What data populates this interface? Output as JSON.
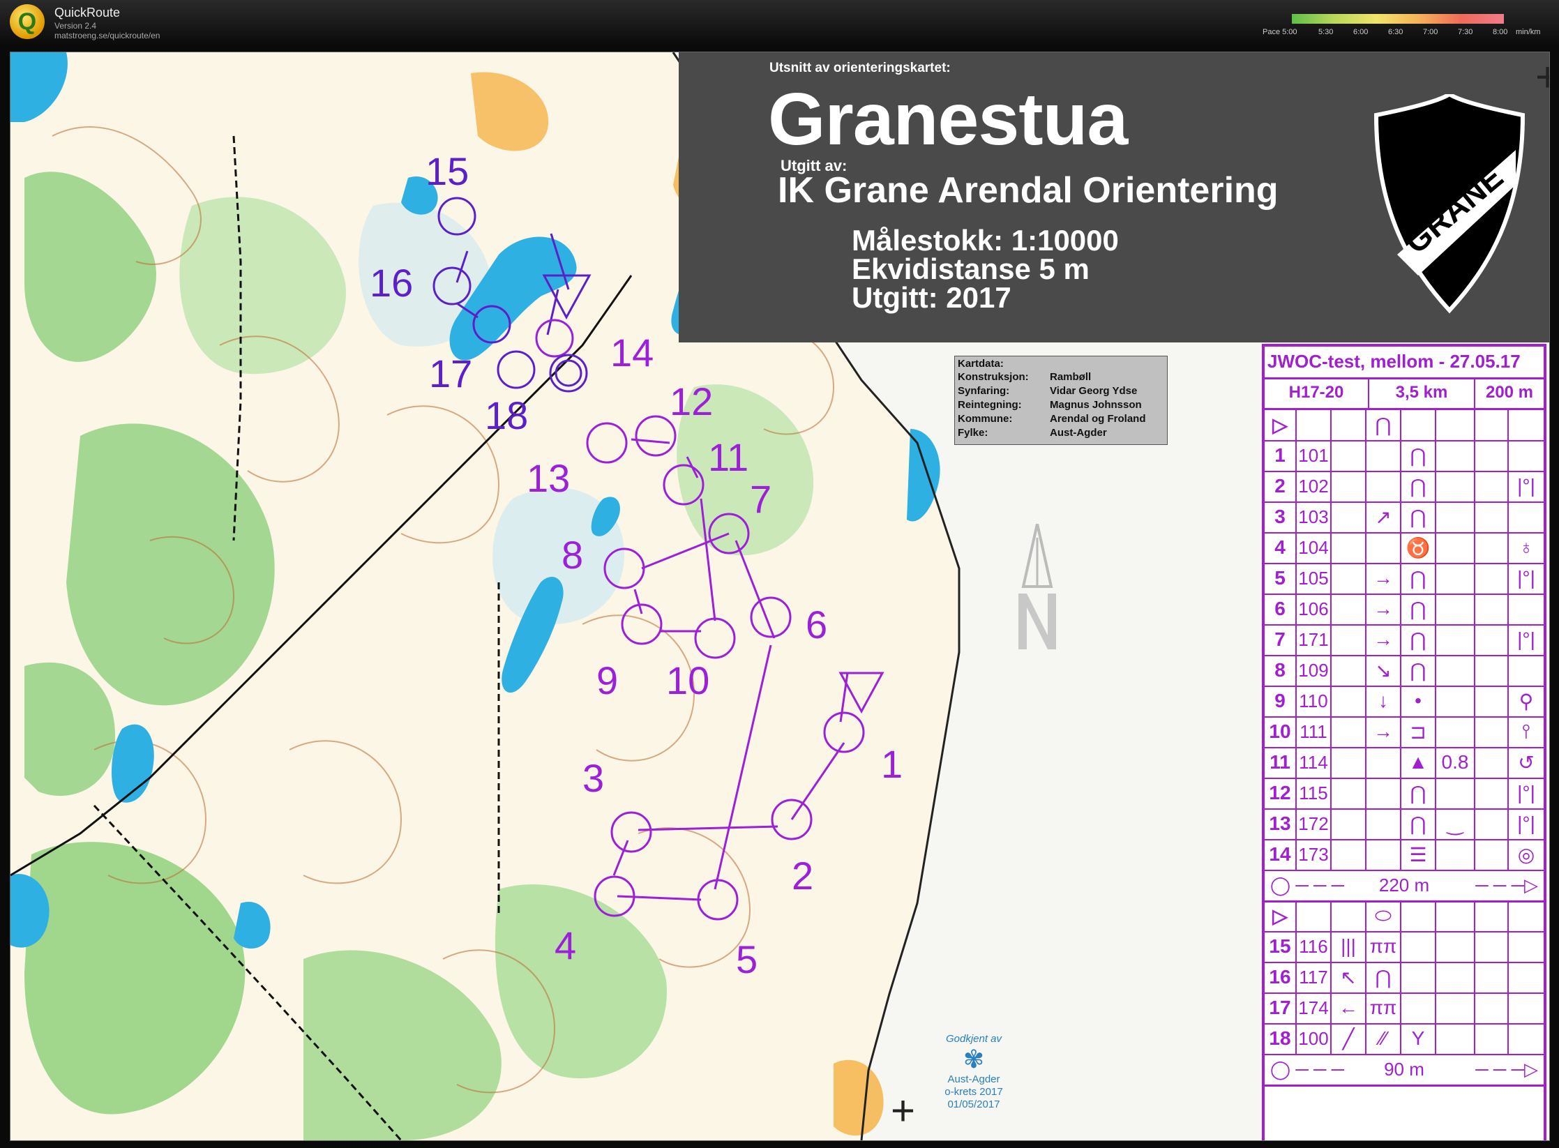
{
  "app": {
    "name": "QuickRoute",
    "version": "Version 2.4",
    "url": "matstroeng.se/quickroute/en",
    "logo_letter": "Q"
  },
  "pace_legend": {
    "labels": [
      "Pace 5:00",
      "5:30",
      "6:00",
      "6:30",
      "7:00",
      "7:30",
      "8:00",
      "min/km"
    ]
  },
  "map": {
    "header_small": "Utsnitt av orienteringskartet:",
    "title": "Granestua",
    "publisher_label": "Utgitt av:",
    "club": "IK Grane Arendal Orientering",
    "scale": "Målestokk: 1:10000",
    "contour": "Ekvidistanse 5 m",
    "published": "Utgitt: 2017",
    "shield_text": "GRANE",
    "kartdata": {
      "heading": "Kartdata:",
      "rows": [
        {
          "k": "Konstruksjon:",
          "v": "Rambøll"
        },
        {
          "k": "Synfaring:",
          "v": "Vidar Georg Ydse"
        },
        {
          "k": "Reintegning:",
          "v": "Magnus Johnsson"
        },
        {
          "k": "Kommune:",
          "v": "Arendal og Froland"
        },
        {
          "k": "Fylke:",
          "v": "Aust-Agder"
        }
      ]
    },
    "approved": {
      "line1": "Godkjent av",
      "line2": "Aust-Agder",
      "line3": "o-krets 2017",
      "line4": "01/05/2017"
    },
    "control_labels": [
      "1",
      "2",
      "3",
      "4",
      "5",
      "6",
      "7",
      "8",
      "9",
      "10",
      "11",
      "12",
      "13",
      "14",
      "15",
      "16",
      "17",
      "18"
    ]
  },
  "control_card": {
    "title": "JWOC-test, mellom - 27.05.17",
    "class": "H17-20",
    "length": "3,5 km",
    "climb": "200 m",
    "start_symbol": "▷",
    "start_feature": "⋂",
    "rows": [
      {
        "n": "1",
        "code": "101",
        "dir": "",
        "feat": "⋂",
        "extra": "",
        "loc": ""
      },
      {
        "n": "2",
        "code": "102",
        "dir": "",
        "feat": "⋂",
        "extra": "",
        "loc": "|°|"
      },
      {
        "n": "3",
        "code": "103",
        "dir": "↗",
        "feat": "⋂",
        "extra": "",
        "loc": ""
      },
      {
        "n": "4",
        "code": "104",
        "dir": "",
        "feat": "♉",
        "extra": "",
        "loc": "♁"
      },
      {
        "n": "5",
        "code": "105",
        "dir": "→",
        "feat": "⋂",
        "extra": "",
        "loc": "|°|"
      },
      {
        "n": "6",
        "code": "106",
        "dir": "→",
        "feat": "⋂",
        "extra": "",
        "loc": ""
      },
      {
        "n": "7",
        "code": "171",
        "dir": "→",
        "feat": "⋂",
        "extra": "",
        "loc": "|°|"
      },
      {
        "n": "8",
        "code": "109",
        "dir": "↘",
        "feat": "⋂",
        "extra": "",
        "loc": ""
      },
      {
        "n": "9",
        "code": "110",
        "dir": "↓",
        "feat": "•",
        "extra": "",
        "loc": "⚲"
      },
      {
        "n": "10",
        "code": "111",
        "dir": "→",
        "feat": "⊐",
        "extra": "",
        "loc": "⫯"
      },
      {
        "n": "11",
        "code": "114",
        "dir": "",
        "feat": "▲",
        "extra": "0.8",
        "loc": "↺"
      },
      {
        "n": "12",
        "code": "115",
        "dir": "",
        "feat": "⋂",
        "extra": "",
        "loc": "|°|"
      },
      {
        "n": "13",
        "code": "172",
        "dir": "",
        "feat": "⋂",
        "extra": "‿",
        "loc": "|°|"
      },
      {
        "n": "14",
        "code": "173",
        "dir": "",
        "feat": "☰",
        "extra": "",
        "loc": "◎"
      }
    ],
    "leg1": "220 m",
    "start2_symbol": "▷",
    "start2_feature": "⬭",
    "rows2": [
      {
        "n": "15",
        "code": "116",
        "dir": "|||",
        "feat": "ππ",
        "extra": "",
        "loc": ""
      },
      {
        "n": "16",
        "code": "117",
        "dir": "↖",
        "feat": "⋂",
        "extra": "",
        "loc": ""
      },
      {
        "n": "17",
        "code": "174",
        "dir": "←",
        "feat": "ππ",
        "extra": "",
        "loc": ""
      },
      {
        "n": "18",
        "code": "100",
        "dir": "╱",
        "feat": "⁄⁄",
        "extra": "Y",
        "loc": ""
      }
    ],
    "leg2": "90 m"
  },
  "colors": {
    "purple": "#a01fd0",
    "course": "#9b20d8",
    "water": "#2fb0e2",
    "green": "#73c46a",
    "brown": "#a0522d"
  }
}
